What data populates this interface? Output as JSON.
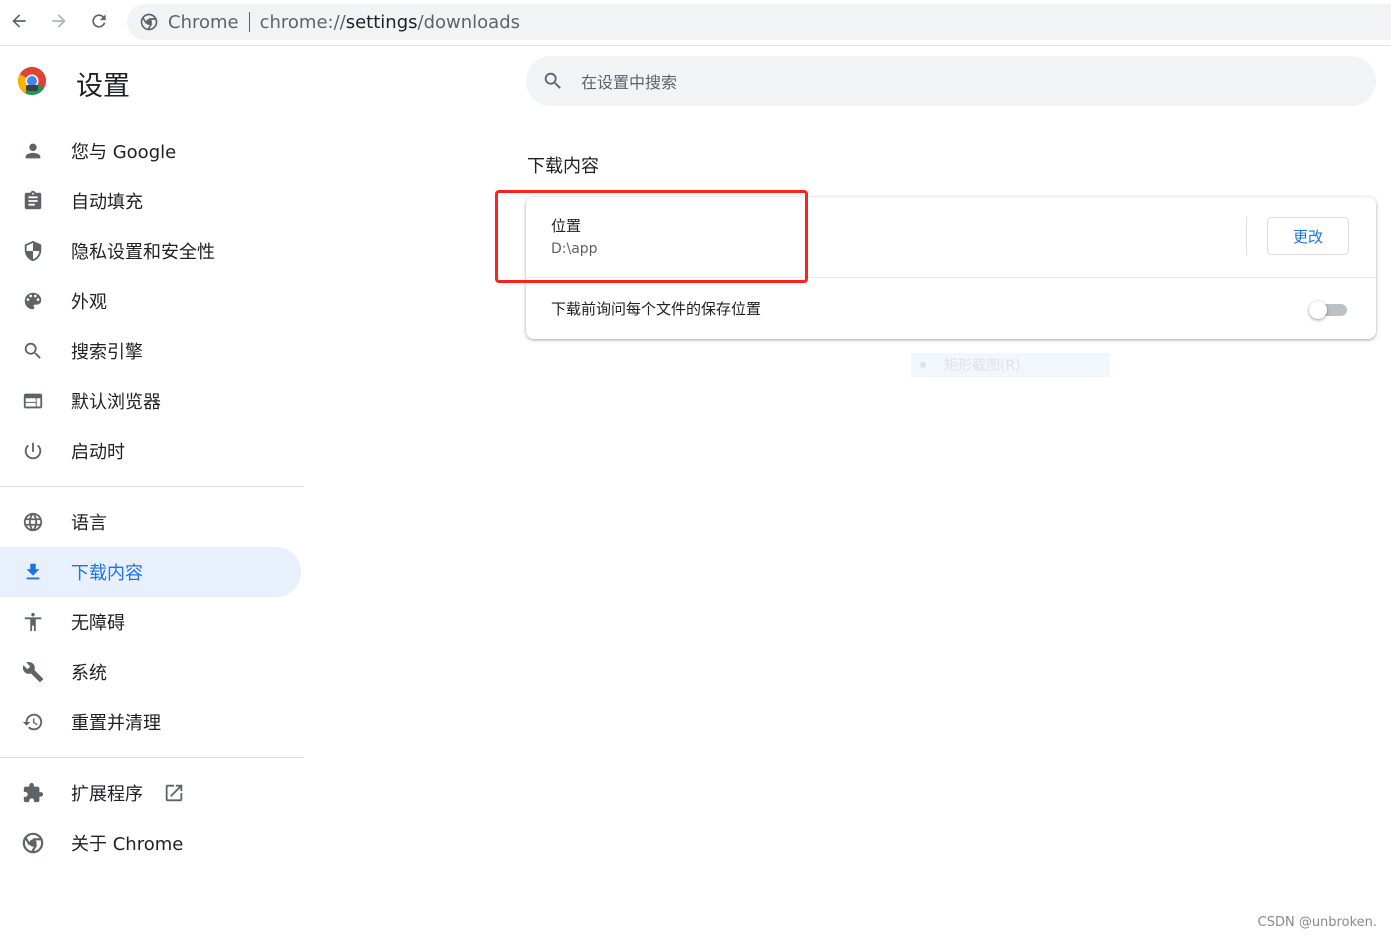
{
  "omnibox": {
    "chip": "Chrome",
    "url_scheme": "chrome://",
    "url_host": "settings",
    "url_path": "/downloads"
  },
  "header": {
    "title": "设置",
    "search_placeholder": "在设置中搜索"
  },
  "sidebar": {
    "items": [
      {
        "label": "您与 Google",
        "icon": "person-icon"
      },
      {
        "label": "自动填充",
        "icon": "clipboard-icon"
      },
      {
        "label": "隐私设置和安全性",
        "icon": "shield-icon"
      },
      {
        "label": "外观",
        "icon": "palette-icon"
      },
      {
        "label": "搜索引擎",
        "icon": "search-icon"
      },
      {
        "label": "默认浏览器",
        "icon": "browser-window-icon"
      },
      {
        "label": "启动时",
        "icon": "power-icon"
      },
      {
        "label": "语言",
        "icon": "globe-icon"
      },
      {
        "label": "下载内容",
        "icon": "download-icon",
        "active": true
      },
      {
        "label": "无障碍",
        "icon": "accessibility-icon"
      },
      {
        "label": "系统",
        "icon": "wrench-icon"
      },
      {
        "label": "重置并清理",
        "icon": "history-icon"
      },
      {
        "label": "扩展程序",
        "icon": "puzzle-icon"
      },
      {
        "label": "关于 Chrome",
        "icon": "chrome-icon"
      }
    ]
  },
  "main": {
    "section_title": "下载内容",
    "location": {
      "label": "位置",
      "value": "D:\\app",
      "change_button": "更改"
    },
    "ask_before_download": {
      "label": "下载前询问每个文件的保存位置",
      "enabled": false
    }
  },
  "overlay": {
    "ghost_menu_item": "矩形截图(R)"
  },
  "watermark": "CSDN @unbroken.",
  "colors": {
    "accent": "#1a73e8",
    "active_bg": "#e8f0fe",
    "highlight_box": "#ff2020"
  }
}
